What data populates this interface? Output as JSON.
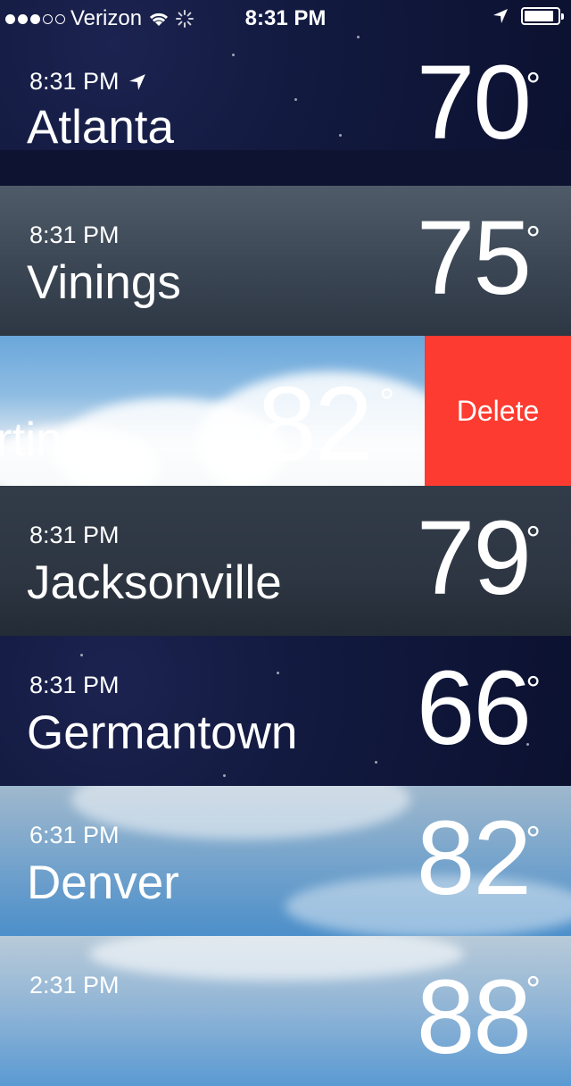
{
  "status_bar": {
    "carrier": "Verizon",
    "time": "8:31 PM",
    "signal_bars_filled": 3,
    "signal_bars_total": 5,
    "battery_level": 0.9,
    "icons": [
      "wifi-icon",
      "activity-spinner-icon",
      "location-arrow-icon",
      "battery-icon"
    ]
  },
  "cities": [
    {
      "time": "8:31 PM",
      "name": "Atlanta",
      "temp": "70",
      "degree": "°",
      "location": true
    },
    {
      "time": "8:31 PM",
      "name": "Vinings",
      "temp": "75",
      "degree": "°"
    },
    {
      "time": "",
      "name": "rtino",
      "temp": "82",
      "degree": "°",
      "swiped": true
    },
    {
      "time": "8:31 PM",
      "name": "Jacksonville",
      "temp": "79",
      "degree": "°"
    },
    {
      "time": "8:31 PM",
      "name": "Germantown",
      "temp": "66",
      "degree": "°"
    },
    {
      "time": "6:31 PM",
      "name": "Denver",
      "temp": "82",
      "degree": "°"
    },
    {
      "time": "2:31 PM",
      "name": "",
      "temp": "88",
      "degree": "°"
    }
  ],
  "delete_label": "Delete",
  "colors": {
    "delete": "#fd3b30"
  }
}
